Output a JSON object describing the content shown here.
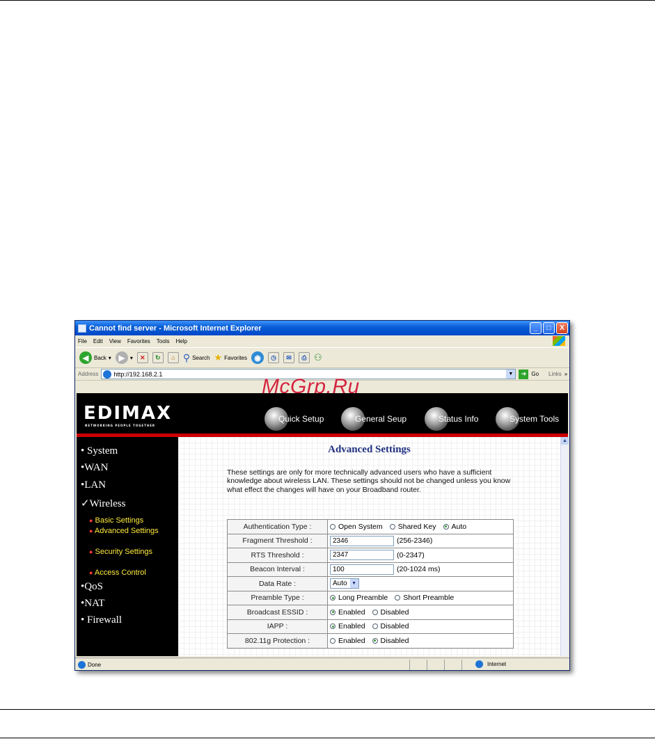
{
  "window": {
    "title": "Cannot find server - Microsoft Internet Explorer",
    "controls": [
      "_",
      "□",
      "X"
    ]
  },
  "menu": [
    "File",
    "Edit",
    "View",
    "Favorites",
    "Tools",
    "Help"
  ],
  "toolbar": {
    "back_label": "Back",
    "search_label": "Search",
    "favorites_label": "Favorites"
  },
  "address": {
    "label": "Address",
    "url": "http://192.168.2.1",
    "go_label": "Go",
    "links_label": "Links"
  },
  "watermark": "McGrp.Ru",
  "brand": {
    "logo": "EDIMAX",
    "tagline": "NETWORKING PEOPLE TOGETHER",
    "nav": [
      "Quick Setup",
      "General Seup",
      "Status Info",
      "System Tools"
    ]
  },
  "sidebar": {
    "items": [
      "System",
      "WAN",
      "LAN",
      "Wireless",
      "QoS",
      "NAT",
      "Firewall"
    ],
    "wireless_sub": [
      "Basic Settings",
      "Advanced Settings",
      "Security Settings",
      "Access Control"
    ]
  },
  "page": {
    "title": "Advanced Settings",
    "description": "These settings are only for more technically advanced users who have a sufficient knowledge about wireless LAN. These settings should not be changed unless you know what effect the changes will have on your Broadband router."
  },
  "settings": {
    "auth_label": "Authentication Type :",
    "auth_options": [
      "Open System",
      "Shared Key",
      "Auto"
    ],
    "fragment_label": "Fragment Threshold :",
    "fragment_value": "2346",
    "fragment_range": "(256-2346)",
    "rts_label": "RTS Threshold :",
    "rts_value": "2347",
    "rts_range": "(0-2347)",
    "beacon_label": "Beacon Interval :",
    "beacon_value": "100",
    "beacon_range": "(20-1024 ms)",
    "rate_label": "Data Rate :",
    "rate_value": "Auto",
    "preamble_label": "Preamble Type :",
    "preamble_options": [
      "Long Preamble",
      "Short Preamble"
    ],
    "essid_label": "Broadcast ESSID :",
    "iapp_label": "IAPP :",
    "prot_label": "802.11g Protection :",
    "enabled": "Enabled",
    "disabled": "Disabled"
  },
  "status": {
    "text": "Done",
    "zone": "Internet"
  }
}
